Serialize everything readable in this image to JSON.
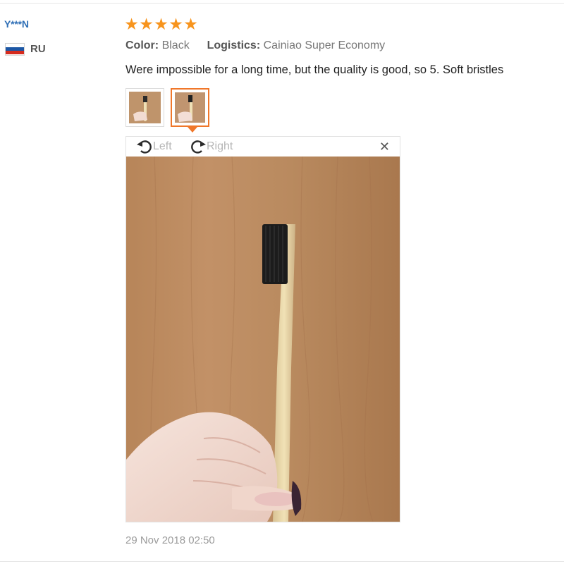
{
  "reviewer": {
    "name": "Y***N",
    "country": "RU",
    "flag_colors": [
      "#ffffff",
      "#1c57a5",
      "#d52b1e"
    ]
  },
  "review": {
    "rating_stars": 5,
    "star_color": "#f7941d",
    "color_label": "Color:",
    "color_value": "Black",
    "logistics_label": "Logistics:",
    "logistics_value": "Cainiao Super Economy",
    "text": "Were impossible for a long time, but the quality is good, so 5. Soft bristles",
    "date": "29 Nov 2018 02:50"
  },
  "photos": {
    "thumbnail_count": 2,
    "selected_index": 1
  },
  "viewer": {
    "rotate_left_label": "Left",
    "rotate_right_label": "Right",
    "rotate_left_icon": "rotate-ccw-icon",
    "rotate_right_icon": "rotate-cw-icon",
    "close_icon": "close-icon",
    "close_symbol": "✕"
  },
  "colors": {
    "accent": "#f0772a",
    "username": "#2f6fb6"
  }
}
